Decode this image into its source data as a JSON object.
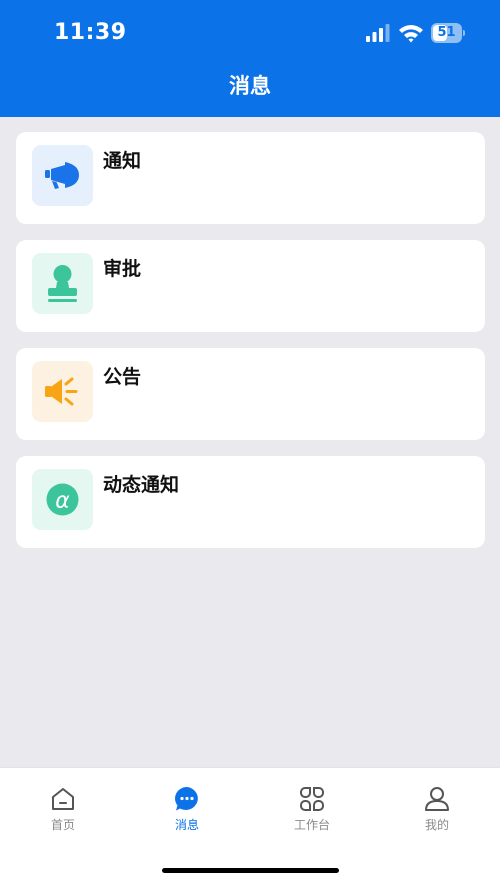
{
  "status_bar": {
    "time": "11:39",
    "battery_level": 51
  },
  "header": {
    "title": "消息"
  },
  "messages": [
    {
      "label": "通知",
      "icon": "megaphone-icon",
      "icon_bg": "#e6f0fc",
      "icon_color": "#1a73e8"
    },
    {
      "label": "审批",
      "icon": "stamp-icon",
      "icon_bg": "#e4f7f0",
      "icon_color": "#3cc59b"
    },
    {
      "label": "公告",
      "icon": "speaker-icon",
      "icon_bg": "#fdf2e1",
      "icon_color": "#f7a515"
    },
    {
      "label": "动态通知",
      "icon": "at-sign-icon",
      "icon_bg": "#e4f7f0",
      "icon_color": "#3cc59b"
    }
  ],
  "tabbar": {
    "tabs": [
      {
        "label": "首页",
        "icon": "home-icon",
        "active": false
      },
      {
        "label": "消息",
        "icon": "chat-icon",
        "active": true
      },
      {
        "label": "工作台",
        "icon": "grid-icon",
        "active": false
      },
      {
        "label": "我的",
        "icon": "user-icon",
        "active": false
      }
    ]
  },
  "colors": {
    "brand": "#0b72e7",
    "background": "#e9e9ee",
    "inactive_tab": "#8a8a8a"
  }
}
